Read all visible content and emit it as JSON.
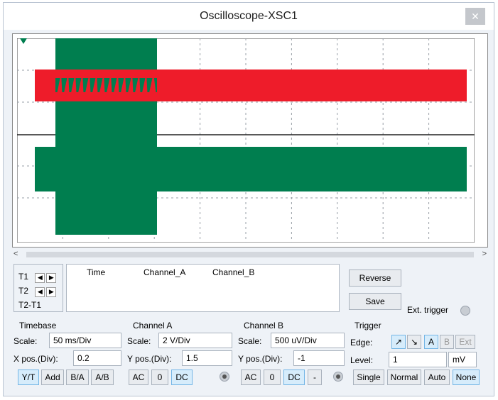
{
  "window": {
    "title": "Oscilloscope-XSC1",
    "close_glyph": "✕"
  },
  "scroll": {
    "left": "<",
    "right": ">"
  },
  "cursors": {
    "t1": "T1",
    "t2": "T2",
    "t2t1": "T2-T1"
  },
  "readout": {
    "col_time": "Time",
    "col_a": "Channel_A",
    "col_b": "Channel_B"
  },
  "buttons": {
    "reverse": "Reverse",
    "save": "Save"
  },
  "ext_trigger_label": "Ext. trigger",
  "timebase": {
    "title": "Timebase",
    "scale_label": "Scale:",
    "scale_value": "50 ms/Div",
    "xpos_label": "X pos.(Div):",
    "xpos_value": "0.2",
    "modes": [
      "Y/T",
      "Add",
      "B/A",
      "A/B"
    ],
    "active_mode": "Y/T"
  },
  "channel_a": {
    "title": "Channel A",
    "scale_label": "Scale:",
    "scale_value": "2  V/Div",
    "ypos_label": "Y pos.(Div):",
    "ypos_value": "1.5",
    "coupling": [
      "AC",
      "0",
      "DC"
    ],
    "active": "DC",
    "color": "#ee1c2a"
  },
  "channel_b": {
    "title": "Channel B",
    "scale_label": "Scale:",
    "scale_value": "500 uV/Div",
    "ypos_label": "Y pos.(Div):",
    "ypos_value": "-1",
    "coupling": [
      "AC",
      "0",
      "DC",
      "-"
    ],
    "active": "DC",
    "color": "#007e4f"
  },
  "trigger": {
    "title": "Trigger",
    "edge_label": "Edge:",
    "edge_buttons": [
      "A",
      "B",
      "Ext"
    ],
    "level_label": "Level:",
    "level_value": "1",
    "level_unit": "mV",
    "modes": [
      "Single",
      "Normal",
      "Auto",
      "None"
    ],
    "active_mode": "None"
  }
}
